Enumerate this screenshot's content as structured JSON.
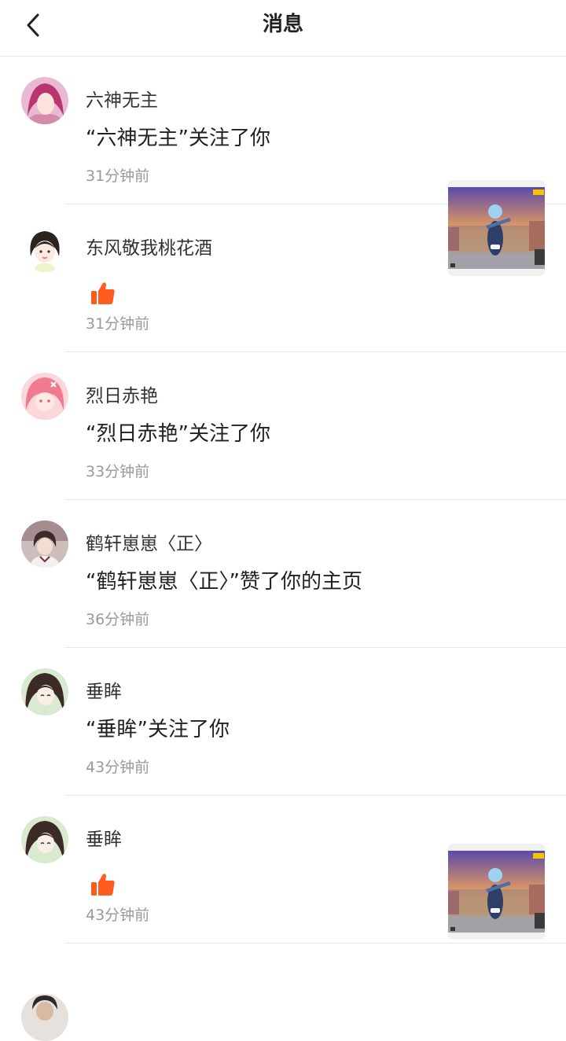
{
  "header": {
    "title": "消息"
  },
  "messages": [
    {
      "nickname": "六神无主",
      "text": "“六神无主”关注了你",
      "time": "31分钟前",
      "type": "follow"
    },
    {
      "nickname": "东风敬我桃花酒",
      "text": "",
      "time": "31分钟前",
      "type": "like",
      "icon": "thumbs-up-icon",
      "has_thumbnail": true
    },
    {
      "nickname": "烈日赤艳",
      "text": "“烈日赤艳”关注了你",
      "time": "33分钟前",
      "type": "follow"
    },
    {
      "nickname": "鹤轩崽崽〈正〉",
      "text": "“鹤轩崽崽〈正〉”赞了你的主页",
      "time": "36分钟前",
      "type": "profile_like"
    },
    {
      "nickname": "垂眸",
      "text": "“垂眸”关注了你",
      "time": "43分钟前",
      "type": "follow"
    },
    {
      "nickname": "垂眸",
      "text": "",
      "time": "43分钟前",
      "type": "like",
      "icon": "thumbs-up-icon",
      "has_thumbnail": true
    }
  ],
  "colors": {
    "like_orange": "#ff5a1f",
    "time_gray": "#999999",
    "divider": "#e8e8e8"
  }
}
